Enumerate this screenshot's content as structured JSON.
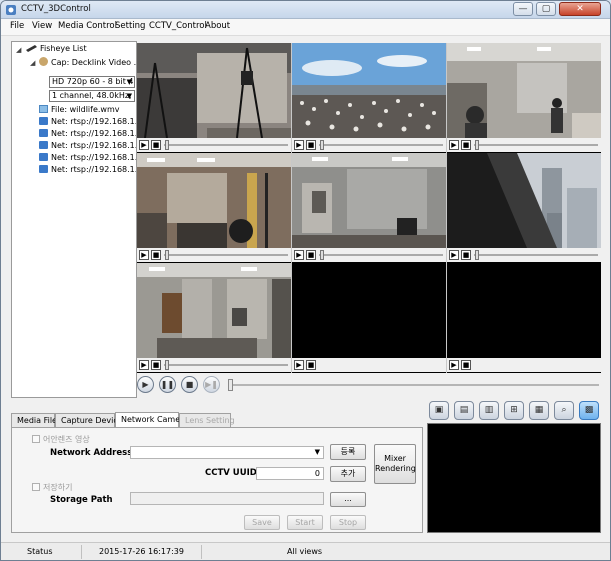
{
  "window": {
    "title": "CCTV_3DControl",
    "controls": [
      "—",
      "▢",
      "✕"
    ]
  },
  "menu": [
    "File",
    "View",
    "Media Control",
    "Setting",
    "CCTV_Control",
    "About"
  ],
  "tree": {
    "root": "Fisheye List",
    "capture": "Cap: Decklink Video ...",
    "video_format": "HD 720p 60 - 8 bit 4",
    "audio_format": "1 channel, 48.0kHz,",
    "file": "File: wildlife.wmv",
    "net_items": [
      "Net: rtsp://192.168.1...",
      "Net: rtsp://192.168.1...",
      "Net: rtsp://192.168.1...",
      "Net: rtsp://192.168.1...",
      "Net: rtsp://192.168.1..."
    ]
  },
  "video_cells": [
    {
      "content": "office-room-tripods"
    },
    {
      "content": "penguin-colony"
    },
    {
      "content": "office-people"
    },
    {
      "content": "office-person-monitor"
    },
    {
      "content": "meeting-room"
    },
    {
      "content": "city-window-view"
    },
    {
      "content": "lab-room"
    },
    {
      "content": "empty"
    },
    {
      "content": "empty"
    }
  ],
  "cell_controls": {
    "play": "▶",
    "stop": "■"
  },
  "playback": {
    "play": "▶",
    "pause": "❚❚",
    "stop": "■",
    "next": "▶❚"
  },
  "view_toolbar": [
    "▣",
    "▤",
    "▥",
    "⊞",
    "▦",
    "⌕",
    "▩"
  ],
  "tabs": [
    {
      "label": "Media File",
      "state": "normal"
    },
    {
      "label": "Capture Device",
      "state": "normal"
    },
    {
      "label": "Network Camera",
      "state": "active"
    },
    {
      "label": "Lens Setting",
      "state": "disabled"
    }
  ],
  "network_panel": {
    "checkbox_fisheye": "어안렌즈 영상",
    "network_address_label": "Network Address",
    "network_address_value": "",
    "register_button": "등록",
    "cctv_uuid_label": "CCTV UUID :",
    "cctv_uuid_value": "0",
    "add_button": "추가",
    "mixer_button": "Mixer Rendering",
    "checkbox_record": "저장하기",
    "storage_path_label": "Storage Path",
    "storage_path_value": "",
    "browse_button": "...",
    "save_button": "Save",
    "start_button": "Start",
    "stop_button": "Stop"
  },
  "status": {
    "label": "Status",
    "timestamp": "2015-17-26 16:17:39",
    "view_mode": "All views"
  }
}
